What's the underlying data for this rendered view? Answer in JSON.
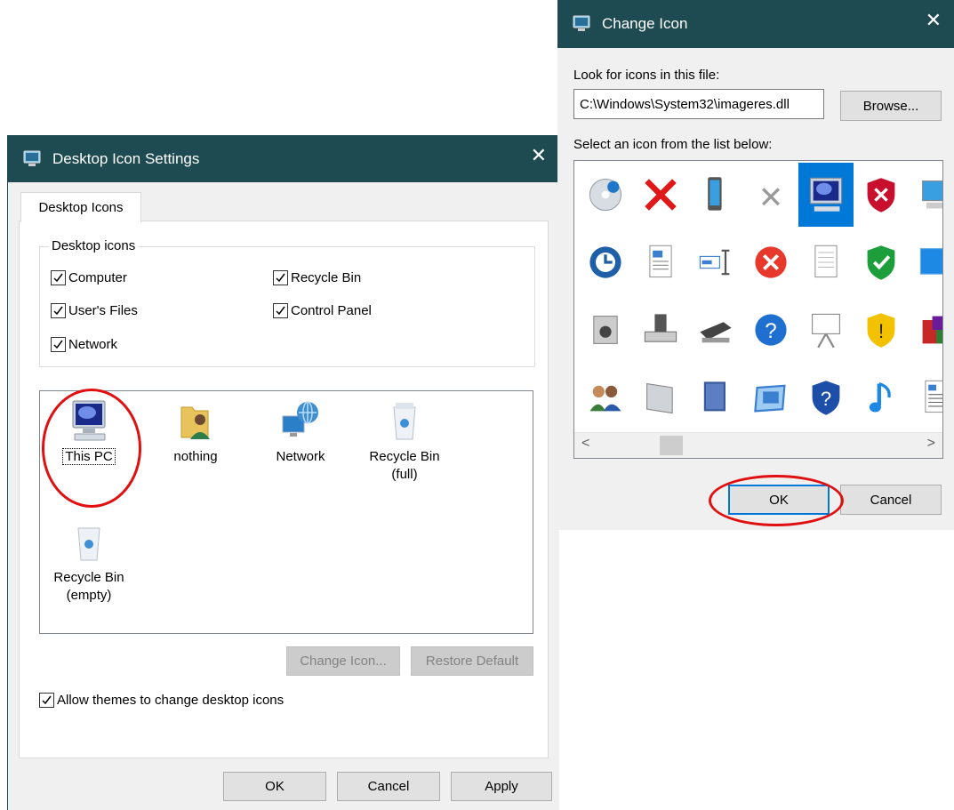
{
  "desktop_icon_settings": {
    "title": "Desktop Icon Settings",
    "close_glyph": "✕",
    "tab_label": "Desktop Icons",
    "group_label": "Desktop icons",
    "checkboxes": [
      {
        "label": "Computer",
        "checked": true
      },
      {
        "label": "Recycle Bin",
        "checked": true
      },
      {
        "label": "User's Files",
        "checked": true
      },
      {
        "label": "Control Panel",
        "checked": true
      },
      {
        "label": "Network",
        "checked": true
      }
    ],
    "icons": [
      {
        "label": "This PC",
        "icon": "computer-icon",
        "selected": true
      },
      {
        "label": "nothing",
        "icon": "user-folder-icon"
      },
      {
        "label": "Network",
        "icon": "network-icon"
      },
      {
        "label": "Recycle Bin\n(full)",
        "icon": "recycle-bin-full-icon"
      },
      {
        "label": "Recycle Bin\n(empty)",
        "icon": "recycle-bin-empty-icon"
      }
    ],
    "change_icon_label": "Change Icon...",
    "restore_default_label": "Restore Default",
    "allow_themes_label": "Allow themes to change desktop icons",
    "allow_themes_checked": true,
    "ok_label": "OK",
    "cancel_label": "Cancel",
    "apply_label": "Apply"
  },
  "change_icon": {
    "title": "Change Icon",
    "close_glyph": "✕",
    "look_label": "Look for icons in this file:",
    "file_path": "C:\\Windows\\System32\\imageres.dll",
    "browse_label": "Browse...",
    "select_label": "Select an icon from the list below:",
    "icons": [
      "cd-music-icon",
      "red-x-icon",
      "phone-icon",
      "small-x-icon",
      "monitor-icon",
      "shield-red-x-icon",
      "computer-icon",
      "picture-icon",
      "clock-icon",
      "document-icon",
      "text-cursor-icon",
      "error-circle-icon",
      "blank-document-icon",
      "shield-check-icon",
      "screen-icon",
      "gear-icon",
      "media-player-icon",
      "drive-icon",
      "scanner-icon",
      "help-icon",
      "projector-icon",
      "shield-warning-icon",
      "apps-icon",
      "folder-icon",
      "users-icon",
      "panel-icon",
      "book-icon",
      "screen-frame-icon",
      "shield-help-icon",
      "music-note-icon",
      "text-document-icon",
      "sheet-icon"
    ],
    "selected_index": 4,
    "ok_label": "OK",
    "cancel_label": "Cancel",
    "scroll_left_glyph": "<",
    "scroll_right_glyph": ">"
  },
  "colors": {
    "titlebar": "#1e4a52",
    "dialog_bg": "#f0f0f0",
    "selection": "#0078d7",
    "highlight_ring": "#e01010"
  }
}
